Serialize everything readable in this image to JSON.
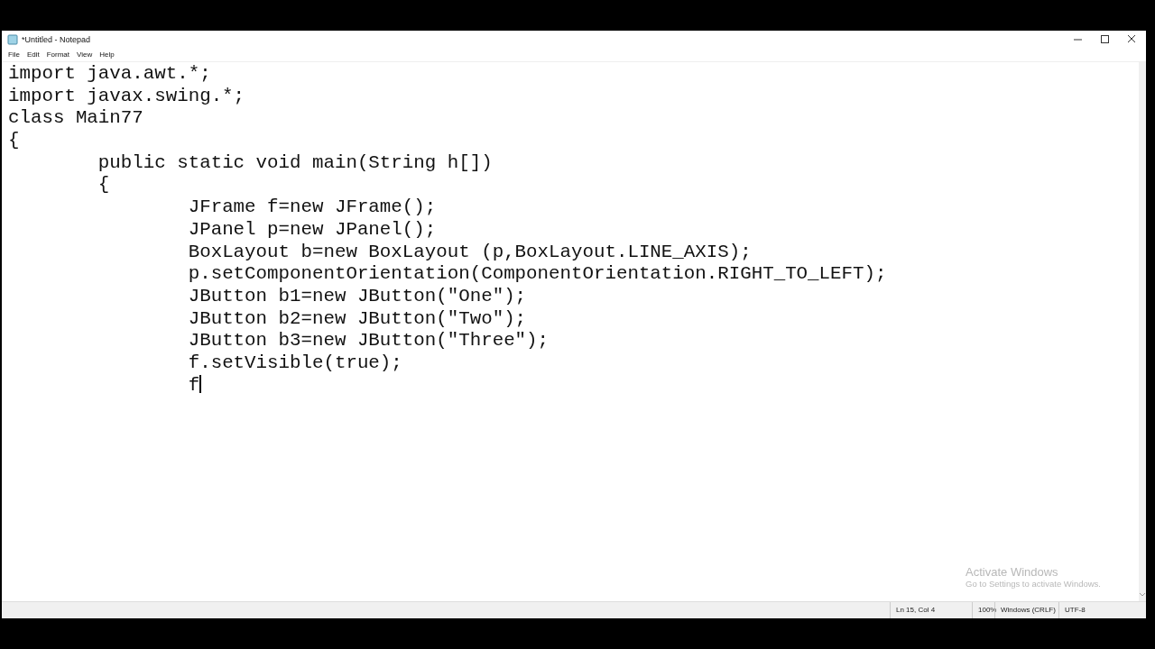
{
  "window": {
    "title": "*Untitled - Notepad"
  },
  "menu": [
    "File",
    "Edit",
    "Format",
    "View",
    "Help"
  ],
  "editor": {
    "lines": [
      "import java.awt.*;",
      "import javax.swing.*;",
      "class Main77",
      "{",
      "\tpublic static void main(String h[])",
      "\t{",
      "\t\tJFrame f=new JFrame();",
      "\t\tJPanel p=new JPanel();",
      "\t\tBoxLayout b=new BoxLayout (p,BoxLayout.LINE_AXIS);",
      "\t\tp.setComponentOrientation(ComponentOrientation.RIGHT_TO_LEFT);",
      "\t\tJButton b1=new JButton(\"One\");",
      "\t\tJButton b2=new JButton(\"Two\");",
      "\t\tJButton b3=new JButton(\"Three\");",
      "\t\tf.setVisible(true);",
      "\t\tf"
    ]
  },
  "activation": {
    "title": "Activate Windows",
    "subtitle": "Go to Settings to activate Windows."
  },
  "status_bar": [
    "Ln 15, Col 4",
    "100%",
    "Windows (CRLF)",
    "UTF-8"
  ]
}
